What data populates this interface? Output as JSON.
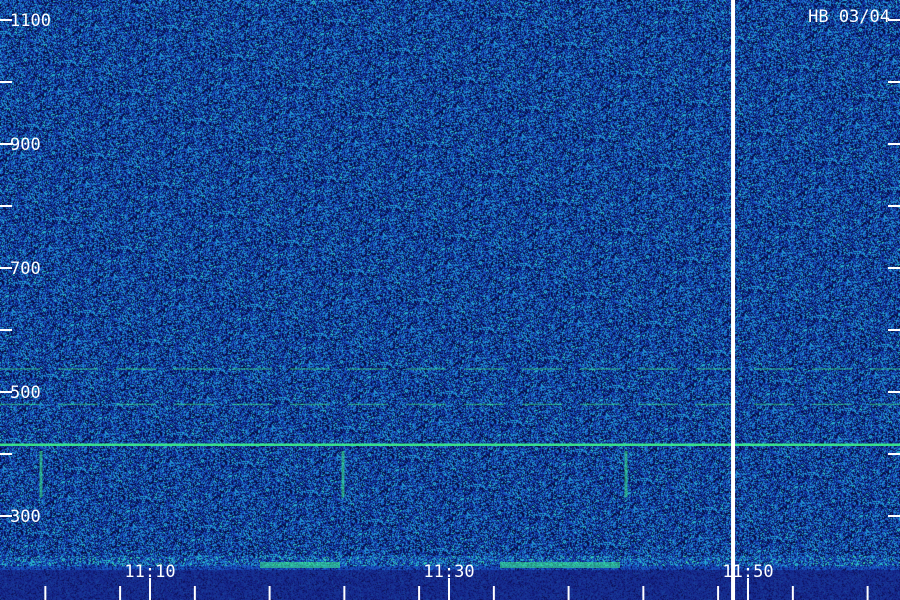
{
  "chart_data": {
    "type": "heatmap",
    "title": "",
    "label_top_right": "HB 03/04",
    "xlabel": "",
    "ylabel": "",
    "x_ticks": [
      "11:10",
      "11:30",
      "11:50"
    ],
    "y_ticks": [
      1100,
      900,
      700,
      500,
      300
    ],
    "ylim": [
      200,
      1150
    ],
    "x_minor_ticks_minutes": [
      -2,
      3,
      8,
      13,
      18,
      23,
      28,
      33,
      38,
      43,
      48,
      53,
      58
    ],
    "y_minor_ticks": [
      1000,
      800,
      600,
      400
    ],
    "colors": {
      "background": "#0b1f6e",
      "noise_low": "#1a3fb0",
      "noise_mid": "#1f7fcf",
      "noise_high": "#2ad0c0",
      "signal": "#3df08a",
      "marker": "#ffffff"
    },
    "features": [
      {
        "kind": "horizontal_line",
        "freq": 415,
        "strength": "strong"
      },
      {
        "kind": "horizontal_line",
        "freq": 537,
        "strength": "weak"
      },
      {
        "kind": "horizontal_line",
        "freq": 480,
        "strength": "weak"
      },
      {
        "kind": "vertical_marker",
        "time": "11:49"
      }
    ]
  }
}
